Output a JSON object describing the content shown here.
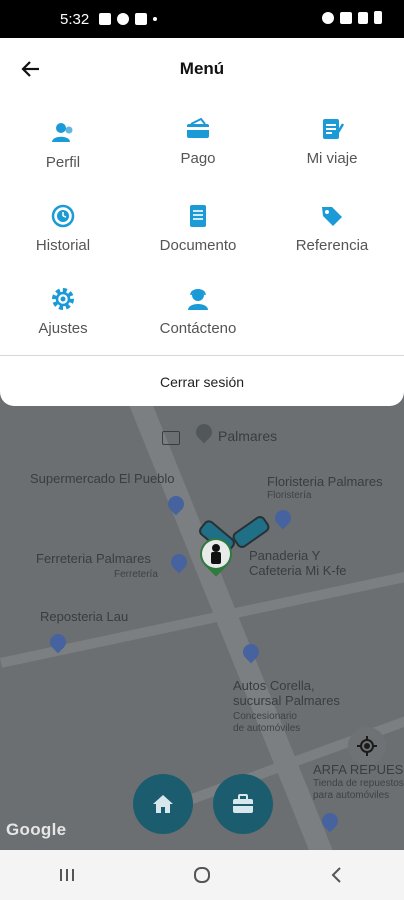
{
  "status_bar": {
    "time": "5:32"
  },
  "menu": {
    "title": "Menú",
    "items": [
      {
        "label": "Perfil",
        "icon": "profile-icon"
      },
      {
        "label": "Pago",
        "icon": "payment-card-icon"
      },
      {
        "label": "Mi viaje",
        "icon": "trip-notes-icon"
      },
      {
        "label": "Historial",
        "icon": "history-clock-icon"
      },
      {
        "label": "Documento",
        "icon": "document-icon"
      },
      {
        "label": "Referencia",
        "icon": "tag-icon"
      },
      {
        "label": "Ajustes",
        "icon": "gear-icon"
      },
      {
        "label": "Contácteno",
        "icon": "contact-icon"
      }
    ],
    "logout_label": "Cerrar sesión",
    "accent_color": "#1a9ad6"
  },
  "map": {
    "labels": {
      "palmares": "Palmares",
      "supermercado": "Supermercado El Pueblo",
      "floristeria": "Floristeria Palmares",
      "floristeria_sub": "Floristería",
      "ferreteria": "Ferreteria Palmares",
      "ferreteria_sub": "Ferretería",
      "panaderia": "Panaderia Y\nCafeteria Mi K-fe",
      "reposteria": "Reposteria Lau",
      "autos": "Autos Corella,\nsucursal Palmares",
      "autos_sub": "Concesionario\nde automóviles",
      "arfa": "ARFA REPUES",
      "arfa_sub": "Tienda de repuestos\npara automóviles"
    },
    "google_logo": "Google"
  }
}
